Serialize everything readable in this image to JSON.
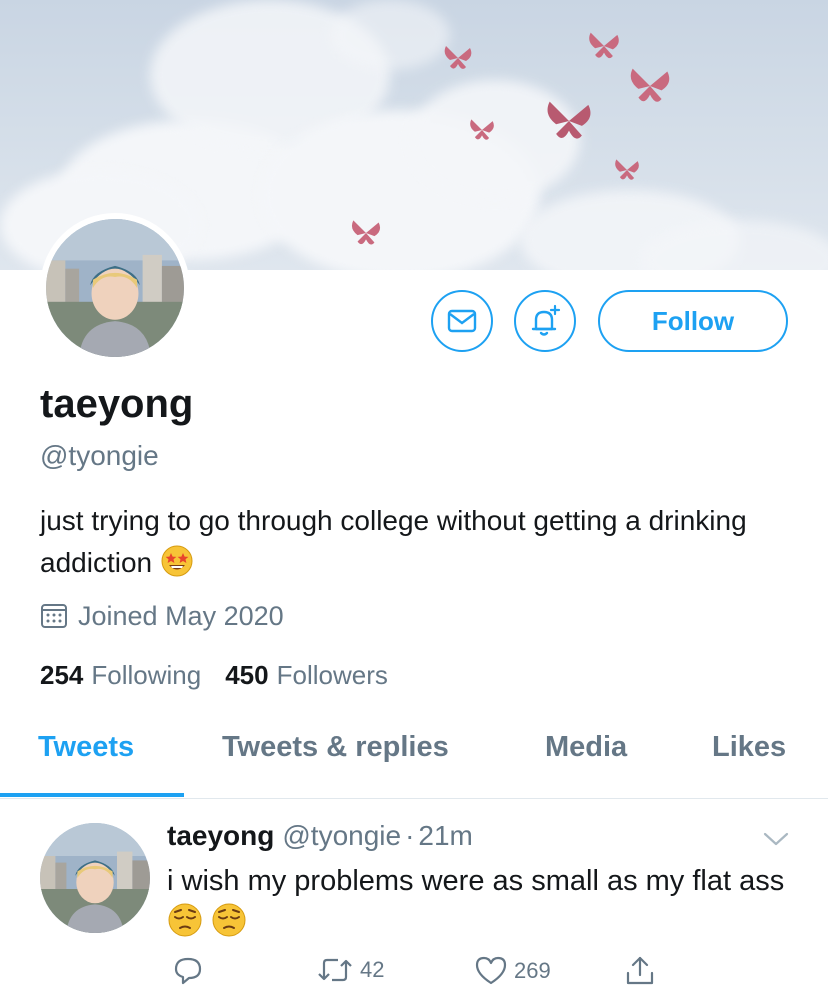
{
  "profile": {
    "display_name": "taeyong",
    "handle": "@tyongie",
    "bio": "just trying to go through college without getting a drinking addiction",
    "bio_emoji": "star-struck",
    "joined": "Joined May 2020",
    "following_count": "254",
    "following_label": "Following",
    "followers_count": "450",
    "followers_label": "Followers"
  },
  "actions": {
    "message_icon": "envelope-icon",
    "notify_icon": "bell-plus-icon",
    "follow_label": "Follow"
  },
  "tabs": [
    {
      "label": "Tweets",
      "active": true
    },
    {
      "label": "Tweets & replies",
      "active": false
    },
    {
      "label": "Media",
      "active": false
    },
    {
      "label": "Likes",
      "active": false
    }
  ],
  "tweet": {
    "name": "taeyong",
    "handle": "@tyongie",
    "dot": "·",
    "time": "21m",
    "text": "i wish my problems were as small as my flat ass",
    "emojis": [
      "pensive",
      "pensive"
    ],
    "reply_count": "",
    "retweet_count": "42",
    "like_count": "269"
  },
  "colors": {
    "accent": "#1da1f2",
    "secondary_text": "#657786",
    "primary_text": "#14171a",
    "butterfly": "#c96a7f"
  }
}
